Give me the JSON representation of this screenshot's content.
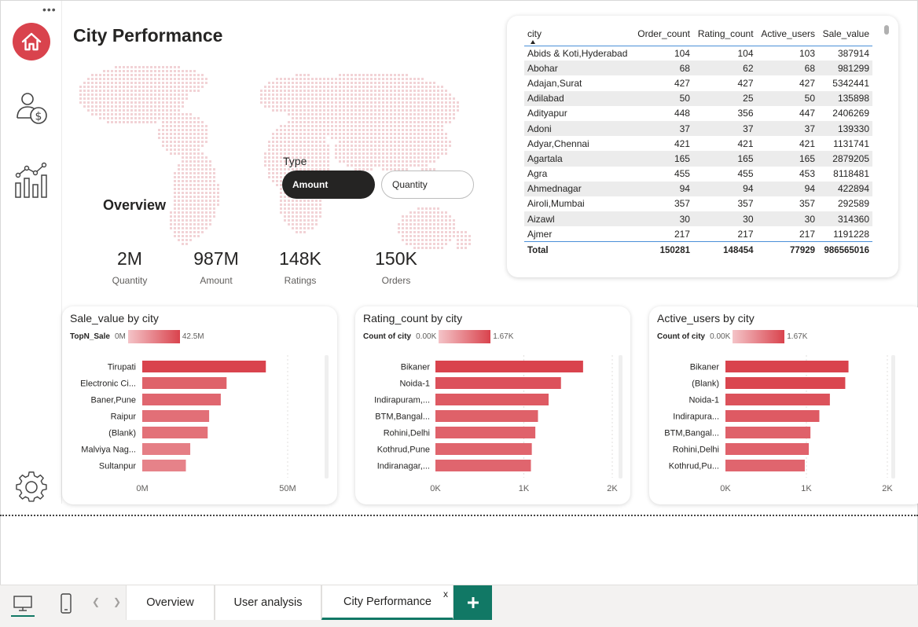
{
  "page": {
    "title": "City Performance"
  },
  "nav": {
    "menu_icon": "more-dots-icon",
    "items": [
      {
        "id": "home",
        "icon": "home-icon"
      },
      {
        "id": "user-analysis",
        "icon": "user-dollar-icon"
      },
      {
        "id": "analytics",
        "icon": "bar-chart-icon"
      },
      {
        "id": "settings",
        "icon": "gear-icon"
      }
    ]
  },
  "type_filter": {
    "label": "Type",
    "options": [
      "Amount",
      "Quantity"
    ],
    "selected": "Amount"
  },
  "overview": {
    "title": "Overview",
    "kpis": [
      {
        "value": "2M",
        "label": "Quantity"
      },
      {
        "value": "987M",
        "label": "Amount"
      },
      {
        "value": "148K",
        "label": "Ratings"
      },
      {
        "value": "150K",
        "label": "Orders"
      }
    ]
  },
  "table": {
    "columns": [
      "city",
      "Order_count",
      "Rating_count",
      "Active_users",
      "Sale_value"
    ],
    "rows": [
      [
        "Abids & Koti,Hyderabad",
        "104",
        "104",
        "103",
        "387914"
      ],
      [
        "Abohar",
        "68",
        "62",
        "68",
        "981299"
      ],
      [
        "Adajan,Surat",
        "427",
        "427",
        "427",
        "5342441"
      ],
      [
        "Adilabad",
        "50",
        "25",
        "50",
        "135898"
      ],
      [
        "Adityapur",
        "448",
        "356",
        "447",
        "2406269"
      ],
      [
        "Adoni",
        "37",
        "37",
        "37",
        "139330"
      ],
      [
        "Adyar,Chennai",
        "421",
        "421",
        "421",
        "1131741"
      ],
      [
        "Agartala",
        "165",
        "165",
        "165",
        "2879205"
      ],
      [
        "Agra",
        "455",
        "455",
        "453",
        "8118481"
      ],
      [
        "Ahmednagar",
        "94",
        "94",
        "94",
        "422894"
      ],
      [
        "Airoli,Mumbai",
        "357",
        "357",
        "357",
        "292589"
      ],
      [
        "Aizawl",
        "30",
        "30",
        "30",
        "314360"
      ],
      [
        "Ajmer",
        "217",
        "217",
        "217",
        "1191228"
      ]
    ],
    "total": [
      "Total",
      "150281",
      "148454",
      "77929",
      "986565016"
    ]
  },
  "colors": {
    "accent": "#d9434d",
    "bar_dark": "#d9434d",
    "bar_light": "#f4c4c8",
    "tab_green": "#117865",
    "dark_pill": "#252423"
  },
  "charts": [
    {
      "title": "Sale_value by city",
      "legend_name": "TopN_Sale",
      "legend_min": "0M",
      "legend_max": "42.5M",
      "tick_labels": [
        "0M",
        "50M"
      ],
      "chart_data": {
        "type": "bar",
        "categories": [
          "Tirupati",
          "Electronic Ci...",
          "Baner,Pune",
          "Raipur",
          "(Blank)",
          "Malviya Nag...",
          "Sultanpur"
        ],
        "values": [
          42.5,
          29,
          27,
          23,
          22.5,
          16.5,
          15
        ],
        "xlim": [
          0,
          50
        ],
        "tick_values": [
          0,
          50
        ]
      }
    },
    {
      "title": "Rating_count by city",
      "legend_name": "Count of city",
      "legend_min": "0.00K",
      "legend_max": "1.67K",
      "tick_labels": [
        "0K",
        "1K",
        "2K"
      ],
      "chart_data": {
        "type": "bar",
        "categories": [
          "Bikaner",
          "Noida-1",
          "Indirapuram,...",
          "BTM,Bangal...",
          "Rohini,Delhi",
          "Kothrud,Pune",
          "Indiranagar,..."
        ],
        "values": [
          1.67,
          1.42,
          1.28,
          1.16,
          1.13,
          1.09,
          1.08
        ],
        "xlim": [
          0,
          2
        ],
        "tick_values": [
          0,
          1,
          2
        ]
      }
    },
    {
      "title": "Active_users by city",
      "legend_name": "Count of city",
      "legend_min": "0.00K",
      "legend_max": "1.67K",
      "tick_labels": [
        "0K",
        "1K",
        "2K"
      ],
      "chart_data": {
        "type": "bar",
        "categories": [
          "Bikaner",
          "(Blank)",
          "Noida-1",
          "Indirapura...",
          "BTM,Bangal...",
          "Rohini,Delhi",
          "Kothrud,Pu..."
        ],
        "values": [
          1.52,
          1.48,
          1.29,
          1.16,
          1.05,
          1.03,
          0.98
        ],
        "xlim": [
          0,
          2
        ],
        "tick_values": [
          0,
          1,
          2
        ]
      }
    }
  ],
  "tabs": {
    "items": [
      "Overview",
      "User analysis",
      "City Performance"
    ],
    "active": "City Performance",
    "close_label": "x",
    "add_label": "+"
  }
}
